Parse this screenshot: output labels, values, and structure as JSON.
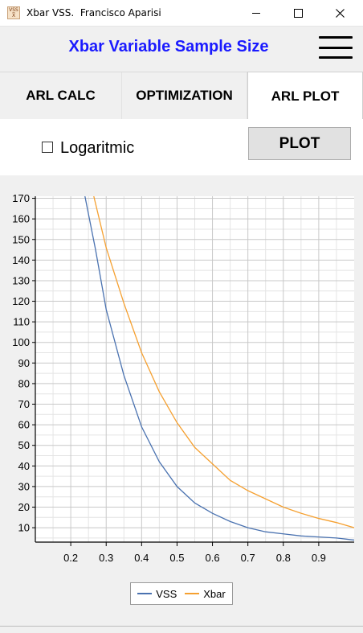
{
  "window": {
    "icon_text": "VSS X̅",
    "title": "Xbar VSS.  Francisco Aparisi"
  },
  "header": {
    "title": "Xbar Variable Sample Size"
  },
  "tabs": [
    {
      "label": "ARL CALC",
      "active": false
    },
    {
      "label": "OPTIMIZATION",
      "active": false
    },
    {
      "label": "ARL PLOT",
      "active": true
    }
  ],
  "controls": {
    "log_label": "Logaritmic",
    "log_checked": false,
    "plot_label": "PLOT"
  },
  "colors": {
    "vss": "#4a72b0",
    "xbar": "#f5a030",
    "title": "#1a1aff"
  },
  "chart_data": {
    "type": "line",
    "xlim": [
      0.1,
      1.0
    ],
    "ylim": [
      3,
      171
    ],
    "x_ticks": [
      "0.2",
      "0.3",
      "0.4",
      "0.5",
      "0.6",
      "0.7",
      "0.8",
      "0.9"
    ],
    "y_ticks": [
      "10",
      "20",
      "30",
      "40",
      "50",
      "60",
      "70",
      "80",
      "90",
      "100",
      "110",
      "120",
      "130",
      "140",
      "150",
      "160",
      "170"
    ],
    "grid": true,
    "legend_position": "bottom-center",
    "series": [
      {
        "name": "VSS",
        "x": [
          0.24,
          0.27,
          0.3,
          0.35,
          0.4,
          0.45,
          0.5,
          0.55,
          0.6,
          0.65,
          0.7,
          0.75,
          0.8,
          0.85,
          0.9,
          0.95,
          1.0
        ],
        "y": [
          171,
          145,
          116,
          84,
          59,
          42,
          30,
          22,
          17,
          13,
          10,
          8,
          7,
          6,
          5.5,
          5,
          4
        ]
      },
      {
        "name": "Xbar",
        "x": [
          0.265,
          0.3,
          0.35,
          0.4,
          0.45,
          0.5,
          0.55,
          0.6,
          0.65,
          0.7,
          0.75,
          0.8,
          0.85,
          0.9,
          0.95,
          1.0
        ],
        "y": [
          171,
          146,
          119,
          95,
          76,
          61,
          49,
          41,
          33,
          28,
          24,
          20,
          17,
          14.5,
          12.5,
          10
        ]
      }
    ]
  }
}
